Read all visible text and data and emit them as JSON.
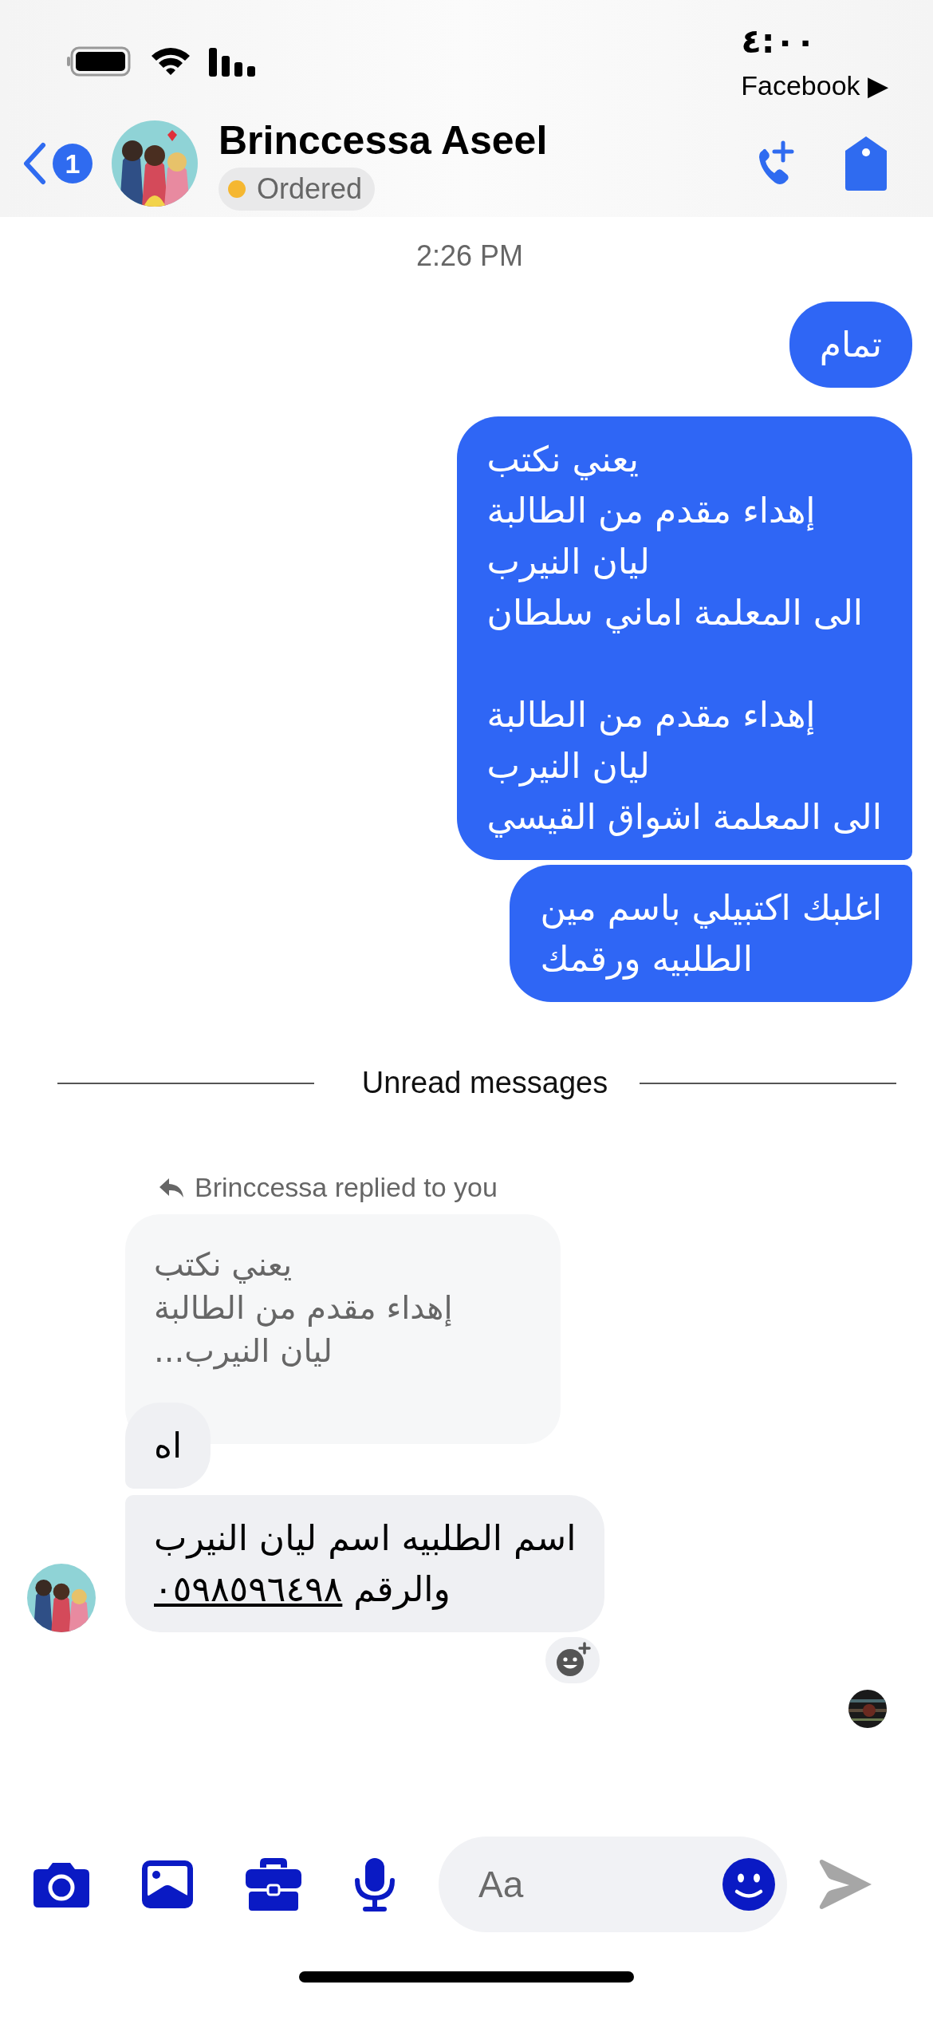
{
  "status_bar": {
    "time": "٤:٠٠",
    "back_app": "Facebook",
    "back_arrow": "▶"
  },
  "header": {
    "back_badge": "1",
    "name": "Brinccessa Aseel",
    "status": "Ordered"
  },
  "timestamp": "2:26 PM",
  "sent_groups": [
    [
      "تمام"
    ],
    [
      "يعني نكتب\nإهداء مقدم من الطالبة\nليان النيرب\nالى المعلمة اماني سلطان\n\nإهداء مقدم من الطالبة\nليان النيرب\nالى المعلمة اشواق القيسي",
      "اغلبك اكتبيلي باسم مين\nالطلبيه ورقمك"
    ]
  ],
  "divider": "Unread messages",
  "reply": {
    "label": "Brinccessa replied to you",
    "quoted": "يعني نكتب\nإهداء مقدم من الطالبة\nليان النيرب..."
  },
  "received": [
    {
      "text": "اه"
    },
    {
      "text": "اسم الطلبيه اسم ليان النيرب\nوالرقم ",
      "link": "٠٥٩٨٥٩٦٤٩٨"
    }
  ],
  "composer": {
    "placeholder": "Aa"
  }
}
